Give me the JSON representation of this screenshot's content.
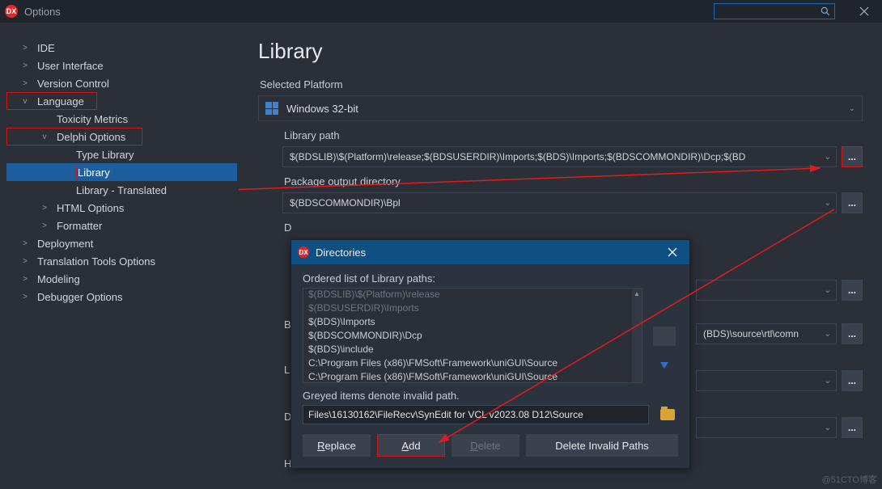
{
  "window": {
    "title": "Options"
  },
  "search": {
    "placeholder": ""
  },
  "sidebar": {
    "items": [
      {
        "exp": ">",
        "label": "IDE"
      },
      {
        "exp": ">",
        "label": "User Interface"
      },
      {
        "exp": ">",
        "label": "Version Control"
      },
      {
        "exp": "v",
        "label": "Language"
      },
      {
        "exp": "",
        "label": "Toxicity Metrics"
      },
      {
        "exp": "v",
        "label": "Delphi Options"
      },
      {
        "exp": "",
        "label": "Type Library"
      },
      {
        "exp": "",
        "label": "Library"
      },
      {
        "exp": "",
        "label": "Library - Translated"
      },
      {
        "exp": ">",
        "label": "HTML Options"
      },
      {
        "exp": ">",
        "label": "Formatter"
      },
      {
        "exp": ">",
        "label": "Deployment"
      },
      {
        "exp": ">",
        "label": "Translation Tools Options"
      },
      {
        "exp": ">",
        "label": "Modeling"
      },
      {
        "exp": ">",
        "label": "Debugger Options"
      }
    ]
  },
  "page": {
    "title": "Library",
    "platform_label": "Selected Platform",
    "platform_value": "Windows 32-bit",
    "libpath_label": "Library path",
    "libpath_value": "$(BDSLIB)\\$(Platform)\\release;$(BDSUSERDIR)\\Imports;$(BDS)\\Imports;$(BDSCOMMONDIR)\\Dcp;$(BD",
    "pkgout_label": "Package output directory",
    "pkgout_value": "$(BDSCOMMONDIR)\\Bpl",
    "hidden_d": "D",
    "hidden_b": "B",
    "hidden_l": "L",
    "hidden_d2": "D",
    "hidden_h": "H",
    "rt_value": "(BDS)\\source\\rtl\\comn"
  },
  "modal": {
    "title": "Directories",
    "list_label": "Ordered list of Library paths:",
    "items": [
      {
        "text": "$(BDSLIB)\\$(Platform)\\release",
        "grey": true
      },
      {
        "text": "$(BDSUSERDIR)\\Imports",
        "grey": true
      },
      {
        "text": "$(BDS)\\Imports",
        "grey": false
      },
      {
        "text": "$(BDSCOMMONDIR)\\Dcp",
        "grey": false
      },
      {
        "text": "$(BDS)\\include",
        "grey": false
      },
      {
        "text": "C:\\Program Files (x86)\\FMSoft\\Framework\\uniGUI\\Source",
        "grey": false
      },
      {
        "text": "C:\\Program Files (x86)\\FMSoft\\Framework\\uniGUI\\Source",
        "grey": false
      }
    ],
    "grey_note": "Greyed items denote invalid path.",
    "edit_value": "Files\\16130162\\FileRecv\\SynEdit for VCL v2023.08 D12\\Source",
    "btn_replace": "Replace",
    "btn_add": "Add",
    "btn_delete": "Delete",
    "btn_invalid": "Delete Invalid Paths"
  },
  "watermark": "@51CTO博客"
}
